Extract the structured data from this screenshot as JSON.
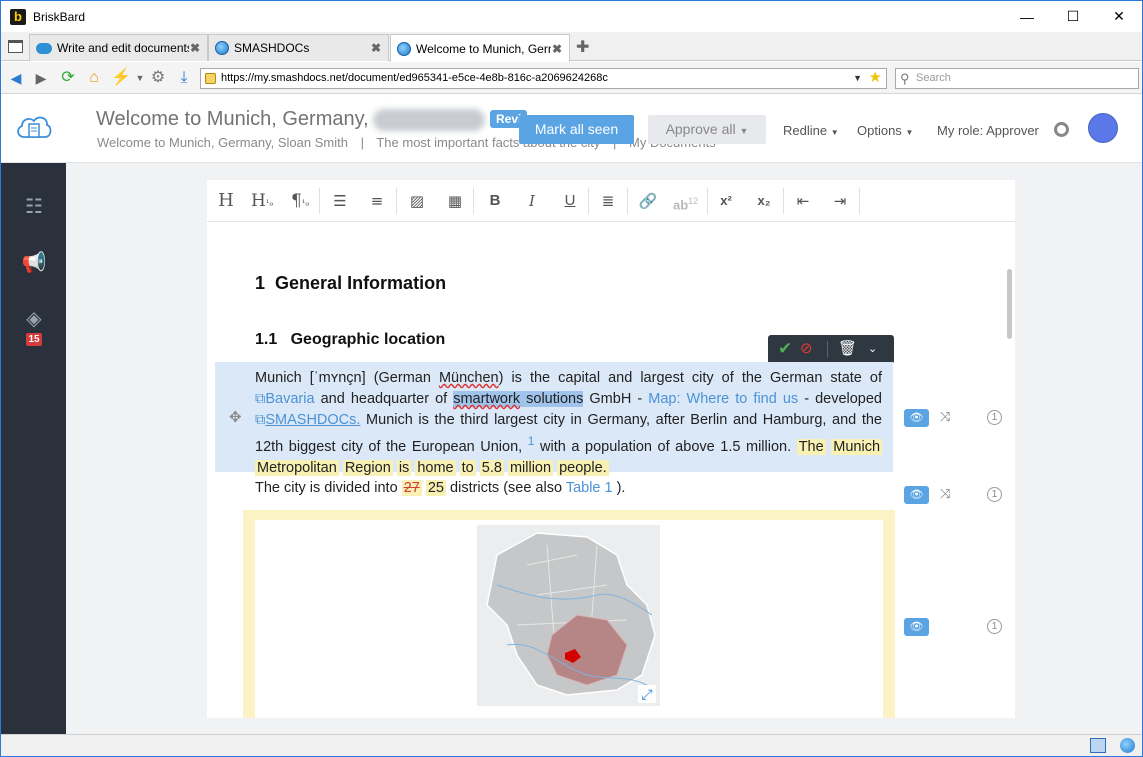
{
  "window": {
    "title": "BriskBard"
  },
  "tabs": [
    {
      "label": "Write and edit documents"
    },
    {
      "label": "SMASHDOCs"
    },
    {
      "label": "Welcome to Munich, Germany"
    }
  ],
  "address": {
    "url": "https://my.smashdocs.net/document/ed965341-e5ce-4e8b-816c-a2069624268c",
    "search_placeholder": "Search"
  },
  "header": {
    "doc_title": "Welcome to Munich, Germany,",
    "status_badge": "Revi",
    "breadcrumb": [
      "Welcome to Munich, Germany, Sloan Smith",
      "|",
      "The most important facts about the city",
      "|",
      "My Documents"
    ],
    "mark_all_seen": "Mark all seen",
    "approve_all": "Approve all",
    "redline": "Redline",
    "options": "Options",
    "role": "My role: Approver"
  },
  "sidebar": {
    "badge_count": "15"
  },
  "toolbar": {
    "h": "H",
    "h1": "H",
    "para": "¶",
    "sup": "x²",
    "sub": "x₂",
    "bold": "B",
    "italic": "I",
    "underline": "U",
    "ab": "ab",
    "ab_num": "12"
  },
  "doc": {
    "h1_num": "1",
    "h1": "General Information",
    "h2_num": "1.1",
    "h2": "Geographic location",
    "p1": {
      "a": "Munich [ˈmʏnçn] (German ",
      "a2": "München",
      "b": ") is the capital and largest city of the German state of ",
      "link_bavaria": "Bavaria",
      "c": " and headquarter of ",
      "sel_a": "smartwork",
      "sel_b": " solutions",
      "d": " GmbH - ",
      "link_map": "Map: Where to find us",
      "e": " - developed ",
      "link_smash": "SMASHDOCs.",
      "f": " Munich is the third largest city in Germany, after Berlin and Hamburg, and the 12th biggest city of the European Union,",
      "footnote": "1",
      "g": " with a population of above 1.5 million.",
      "insert_words": [
        "The",
        "Munich",
        "Metropolitan",
        "Region",
        "is",
        "home",
        "to",
        "5.8",
        "million",
        "people."
      ]
    },
    "p2": {
      "a": "The city is divided into ",
      "deleted": "27",
      "inserted": "25",
      "b": " districts (see also ",
      "link_table": "Table 1",
      "c": " )."
    }
  },
  "colors": {
    "accent": "#5aa4e4",
    "sidebar": "#2a313c",
    "insert_highlight": "#f8f1b3",
    "paragraph_highlight": "#dbe8f7"
  }
}
